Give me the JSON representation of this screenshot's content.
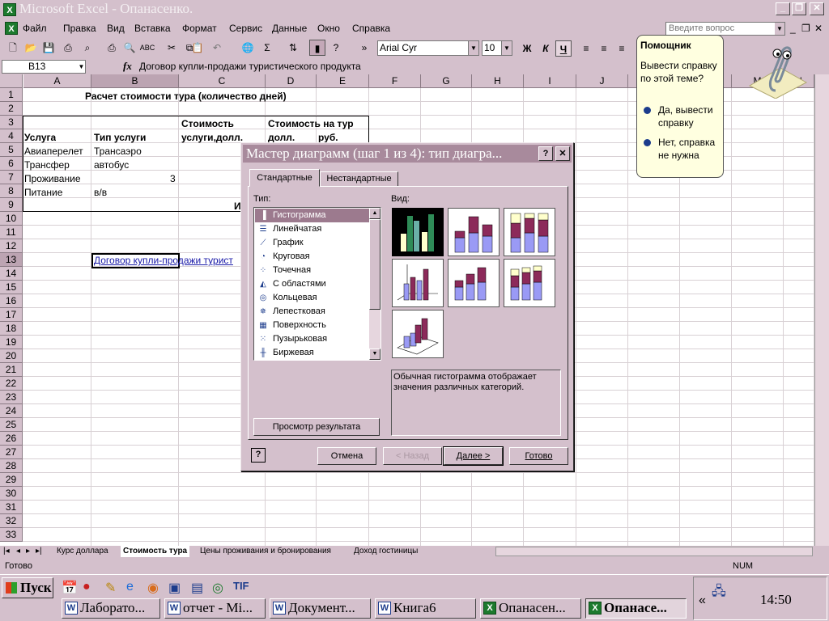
{
  "window": {
    "title": "Microsoft Excel - Опанасенко.",
    "app_icon": "X"
  },
  "menu": {
    "items": [
      "Файл",
      "Правка",
      "Вид",
      "Вставка",
      "Формат",
      "Сервис",
      "Данные",
      "Окно",
      "Справка"
    ],
    "help_placeholder": "Введите вопрос"
  },
  "toolbar": {
    "font": "Arial Cyr",
    "size": "10",
    "bold": "Ж",
    "italic": "К",
    "underline": "Ч"
  },
  "formula": {
    "name_box": "B13",
    "fx": "fx",
    "content": "Договор купли-продажи туристического продукта"
  },
  "grid": {
    "columns": [
      "A",
      "B",
      "C",
      "D",
      "E",
      "F",
      "G",
      "H",
      "I",
      "J",
      "K",
      "L",
      "M",
      "N"
    ],
    "rows": [
      "1",
      "2",
      "3",
      "4",
      "5",
      "6",
      "7",
      "8",
      "9",
      "10",
      "11",
      "12",
      "13",
      "14",
      "15",
      "16",
      "17",
      "18",
      "19",
      "20",
      "21",
      "22",
      "23",
      "24",
      "25",
      "26",
      "27",
      "28",
      "29",
      "30",
      "31",
      "32",
      "33"
    ],
    "title": "Расчет стоимости тура (количество дней)",
    "h_service": "Услуга",
    "h_type": "Тип услуги",
    "h_cost_usd_1": "Стоимость",
    "h_cost_usd_2": "услуги,долл.",
    "h_cost_tour_1": "Стоимость на тур",
    "h_cost_tour_d": "долл.",
    "h_cost_tour_r": "руб.",
    "r5a": "Авиаперелет",
    "r5b": "Трансаэро",
    "r6a": "Трансфер",
    "r6b": "автобус",
    "r7a": "Проживание",
    "r7b": "3",
    "r8a": "Питание",
    "r8b": "в/в",
    "r9": "И",
    "r13b": "Договор купли-продажи турист"
  },
  "sheets": {
    "tabs": [
      "Курс доллара",
      "Стоимость тура",
      "Цены проживания и бронирования",
      "Доход гостиницы"
    ],
    "active": "Стоимость тура"
  },
  "status": {
    "left": "Готово",
    "num": "NUM"
  },
  "dialog": {
    "title": "Мастер диаграмм (шаг 1 из 4): тип диагра...",
    "help_btn": "?",
    "close_btn": "✕",
    "tab_standard": "Стандартные",
    "tab_custom": "Нестандартные",
    "type_label": "Тип:",
    "view_label": "Вид:",
    "types": [
      {
        "label": "Гистограмма",
        "icon": "bar-chart-icon"
      },
      {
        "label": "Линейчатая",
        "icon": "horizontal-bar-icon"
      },
      {
        "label": "График",
        "icon": "line-chart-icon"
      },
      {
        "label": "Круговая",
        "icon": "pie-chart-icon"
      },
      {
        "label": "Точечная",
        "icon": "scatter-icon"
      },
      {
        "label": "С областями",
        "icon": "area-chart-icon"
      },
      {
        "label": "Кольцевая",
        "icon": "donut-icon"
      },
      {
        "label": "Лепестковая",
        "icon": "radar-icon"
      },
      {
        "label": "Поверхность",
        "icon": "surface-icon"
      },
      {
        "label": "Пузырьковая",
        "icon": "bubble-icon"
      },
      {
        "label": "Биржевая",
        "icon": "stock-icon"
      }
    ],
    "description": "Обычная гистограмма отображает значения различных категорий.",
    "preview_btn": "Просмотр результата",
    "cancel": "Отмена",
    "back": "< Назад",
    "next": "Далее >",
    "finish": "Готово"
  },
  "assistant": {
    "title": "Помощник",
    "question": "Вывести справку по этой теме?",
    "opt_yes": "Да, вывести справку",
    "opt_no": "Нет, справка не нужна"
  },
  "taskbar": {
    "start": "Пуск",
    "tasks": [
      {
        "label": "Лаборато...",
        "icon": "W"
      },
      {
        "label": "отчет - Mi...",
        "icon": "W"
      },
      {
        "label": "Документ...",
        "icon": "W"
      },
      {
        "label": "Книга6",
        "icon": "W"
      },
      {
        "label": "Опанасен...",
        "icon": "X"
      },
      {
        "label": "Опанасе...",
        "icon": "X"
      }
    ],
    "clock": "14:50",
    "chevron": "«"
  },
  "colors": {
    "face": "#d4c0cc",
    "selection": "#9c7a8e",
    "bar_maroon": "#8c2a5a",
    "bar_lavender": "#9a9af5",
    "bar_cream": "#ffffcc"
  }
}
